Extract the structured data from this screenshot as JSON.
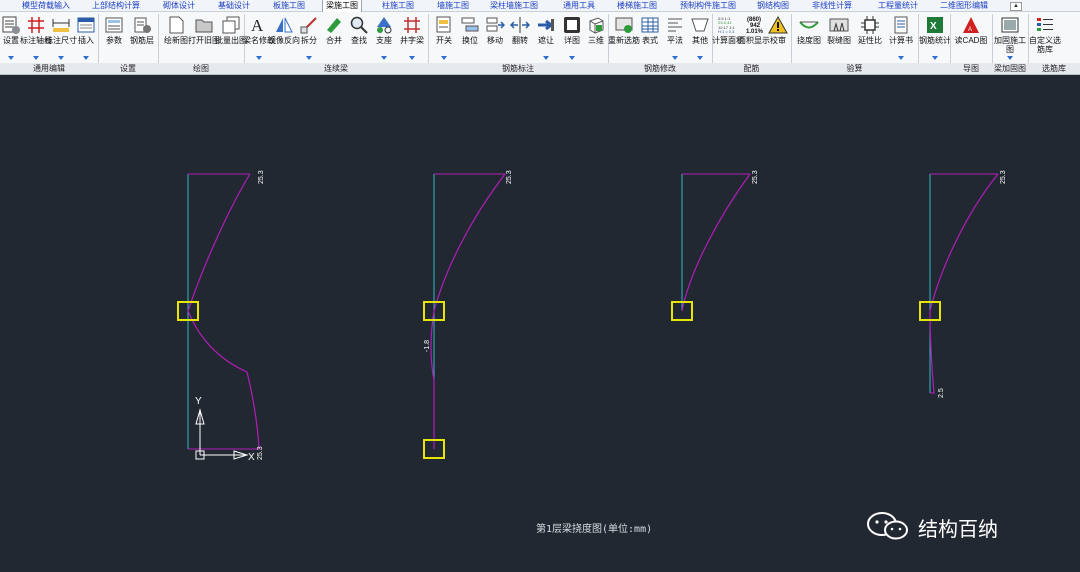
{
  "tabs": [
    {
      "label": "模型荷载输入"
    },
    {
      "label": "上部结构计算"
    },
    {
      "label": "砌体设计"
    },
    {
      "label": "基础设计"
    },
    {
      "label": "板施工图"
    },
    {
      "label": "梁施工图",
      "active": true
    },
    {
      "label": "柱施工图"
    },
    {
      "label": "墙施工图"
    },
    {
      "label": "梁柱墙施工图"
    },
    {
      "label": "通用工具"
    },
    {
      "label": "楼梯施工图"
    },
    {
      "label": "预制构件施工图"
    },
    {
      "label": "钢结构图"
    },
    {
      "label": "非线性计算"
    },
    {
      "label": "工程量统计"
    },
    {
      "label": "二维图形编辑"
    }
  ],
  "ribbon": {
    "buttons": [
      {
        "label": "设置",
        "icon": "settings-icon",
        "dropdown": true
      },
      {
        "label": "标注轴线",
        "icon": "axis-dimension-icon",
        "dropdown": true
      },
      {
        "label": "标注尺寸",
        "icon": "size-dimension-icon",
        "dropdown": true
      },
      {
        "label": "插入",
        "icon": "insert-icon",
        "dropdown": true
      },
      {
        "label": "参数",
        "icon": "parameters-icon",
        "dropdown": false
      },
      {
        "label": "钢筋层",
        "icon": "rebar-layer-icon",
        "dropdown": false
      },
      {
        "label": "绘新图",
        "icon": "new-drawing-icon",
        "dropdown": false
      },
      {
        "label": "打开旧图",
        "icon": "open-drawing-icon",
        "dropdown": false
      },
      {
        "label": "批量出图",
        "icon": "batch-output-icon",
        "dropdown": false
      },
      {
        "label": "梁名修改",
        "icon": "beam-name-edit-icon",
        "dropdown": true
      },
      {
        "label": "镜像反向",
        "icon": "mirror-icon",
        "dropdown": false
      },
      {
        "label": "拆分",
        "icon": "split-icon",
        "dropdown": true
      },
      {
        "label": "合并",
        "icon": "merge-icon",
        "dropdown": false
      },
      {
        "label": "查找",
        "icon": "find-icon",
        "dropdown": false
      },
      {
        "label": "支座",
        "icon": "support-icon",
        "dropdown": true
      },
      {
        "label": "井字梁",
        "icon": "grid-beam-icon",
        "dropdown": true
      },
      {
        "label": "开关",
        "icon": "switch-icon",
        "dropdown": true
      },
      {
        "label": "换位",
        "icon": "swap-icon",
        "dropdown": false
      },
      {
        "label": "移动",
        "icon": "move-icon",
        "dropdown": false
      },
      {
        "label": "翻转",
        "icon": "flip-icon",
        "dropdown": false
      },
      {
        "label": "遮让",
        "icon": "avoid-icon",
        "dropdown": true
      },
      {
        "label": "详图",
        "icon": "detail-icon",
        "dropdown": true
      },
      {
        "label": "三维",
        "icon": "3d-view-icon",
        "dropdown": false
      },
      {
        "label": "重新选筋",
        "icon": "reselect-rebar-icon",
        "dropdown": false
      },
      {
        "label": "表式",
        "icon": "table-icon",
        "dropdown": false
      },
      {
        "label": "平法",
        "icon": "plane-method-icon",
        "dropdown": true
      },
      {
        "label": "其他",
        "icon": "other-icon",
        "dropdown": true
      },
      {
        "label": "计算面积",
        "icon": "calc-area-icon",
        "dropdown": false
      },
      {
        "label": "面积显示",
        "icon": "area-display-icon",
        "dropdown": false
      },
      {
        "label": "校审",
        "icon": "review-warning-icon",
        "dropdown": false
      },
      {
        "label": "挠度图",
        "icon": "deflection-icon",
        "dropdown": false
      },
      {
        "label": "裂缝图",
        "icon": "crack-icon",
        "dropdown": false
      },
      {
        "label": "延性比",
        "icon": "ductility-icon",
        "dropdown": false
      },
      {
        "label": "计算书",
        "icon": "calc-report-icon",
        "dropdown": true
      },
      {
        "label": "钢筋统计",
        "icon": "excel-icon",
        "dropdown": true
      },
      {
        "label": "读CAD图",
        "icon": "cad-read-icon",
        "dropdown": false
      },
      {
        "label": "加固施工图",
        "icon": "reinforce-drawing-icon",
        "dropdown": true
      },
      {
        "label": "自定义选筋库",
        "icon": "custom-rebar-library-icon",
        "dropdown": false
      }
    ],
    "area_icon_lines": [
      "(860)",
      "942",
      "1.01%"
    ],
    "calc_icon_lines": [
      "0:5 1:1",
      "23-0.41",
      "12:17 1:1",
      "H:1 = 0.3"
    ],
    "groups": [
      {
        "label": "通用编辑"
      },
      {
        "label": "设置"
      },
      {
        "label": "绘图"
      },
      {
        "label": "连续梁"
      },
      {
        "label": "钢筋标注"
      },
      {
        "label": "钢筋修改"
      },
      {
        "label": "配筋"
      },
      {
        "label": "验算"
      },
      {
        "label": "导图"
      },
      {
        "label": "梁加固图"
      },
      {
        "label": "选筋库"
      }
    ]
  },
  "drawing": {
    "beams": [
      {
        "label": "25.3",
        "extra_label": "25.3",
        "deflection_shape": "double",
        "nodes": 1
      },
      {
        "label": "25.3",
        "mid_label": "-1.8",
        "deflection_shape": "reverse",
        "nodes": 2
      },
      {
        "label": "25.3",
        "deflection_shape": "single",
        "nodes": 1
      },
      {
        "label": "25.3",
        "tail_label": "2.5",
        "deflection_shape": "tail",
        "nodes": 1
      }
    ],
    "axis_y_label": "Y",
    "axis_x_label": "X",
    "colors": {
      "curve": "#b01db8",
      "member": "#2fb7c7",
      "node": "#e6e600",
      "text": "#ffffff"
    }
  },
  "caption": "第1层梁挠度图(单位:mm)",
  "watermark": "结构百纳"
}
